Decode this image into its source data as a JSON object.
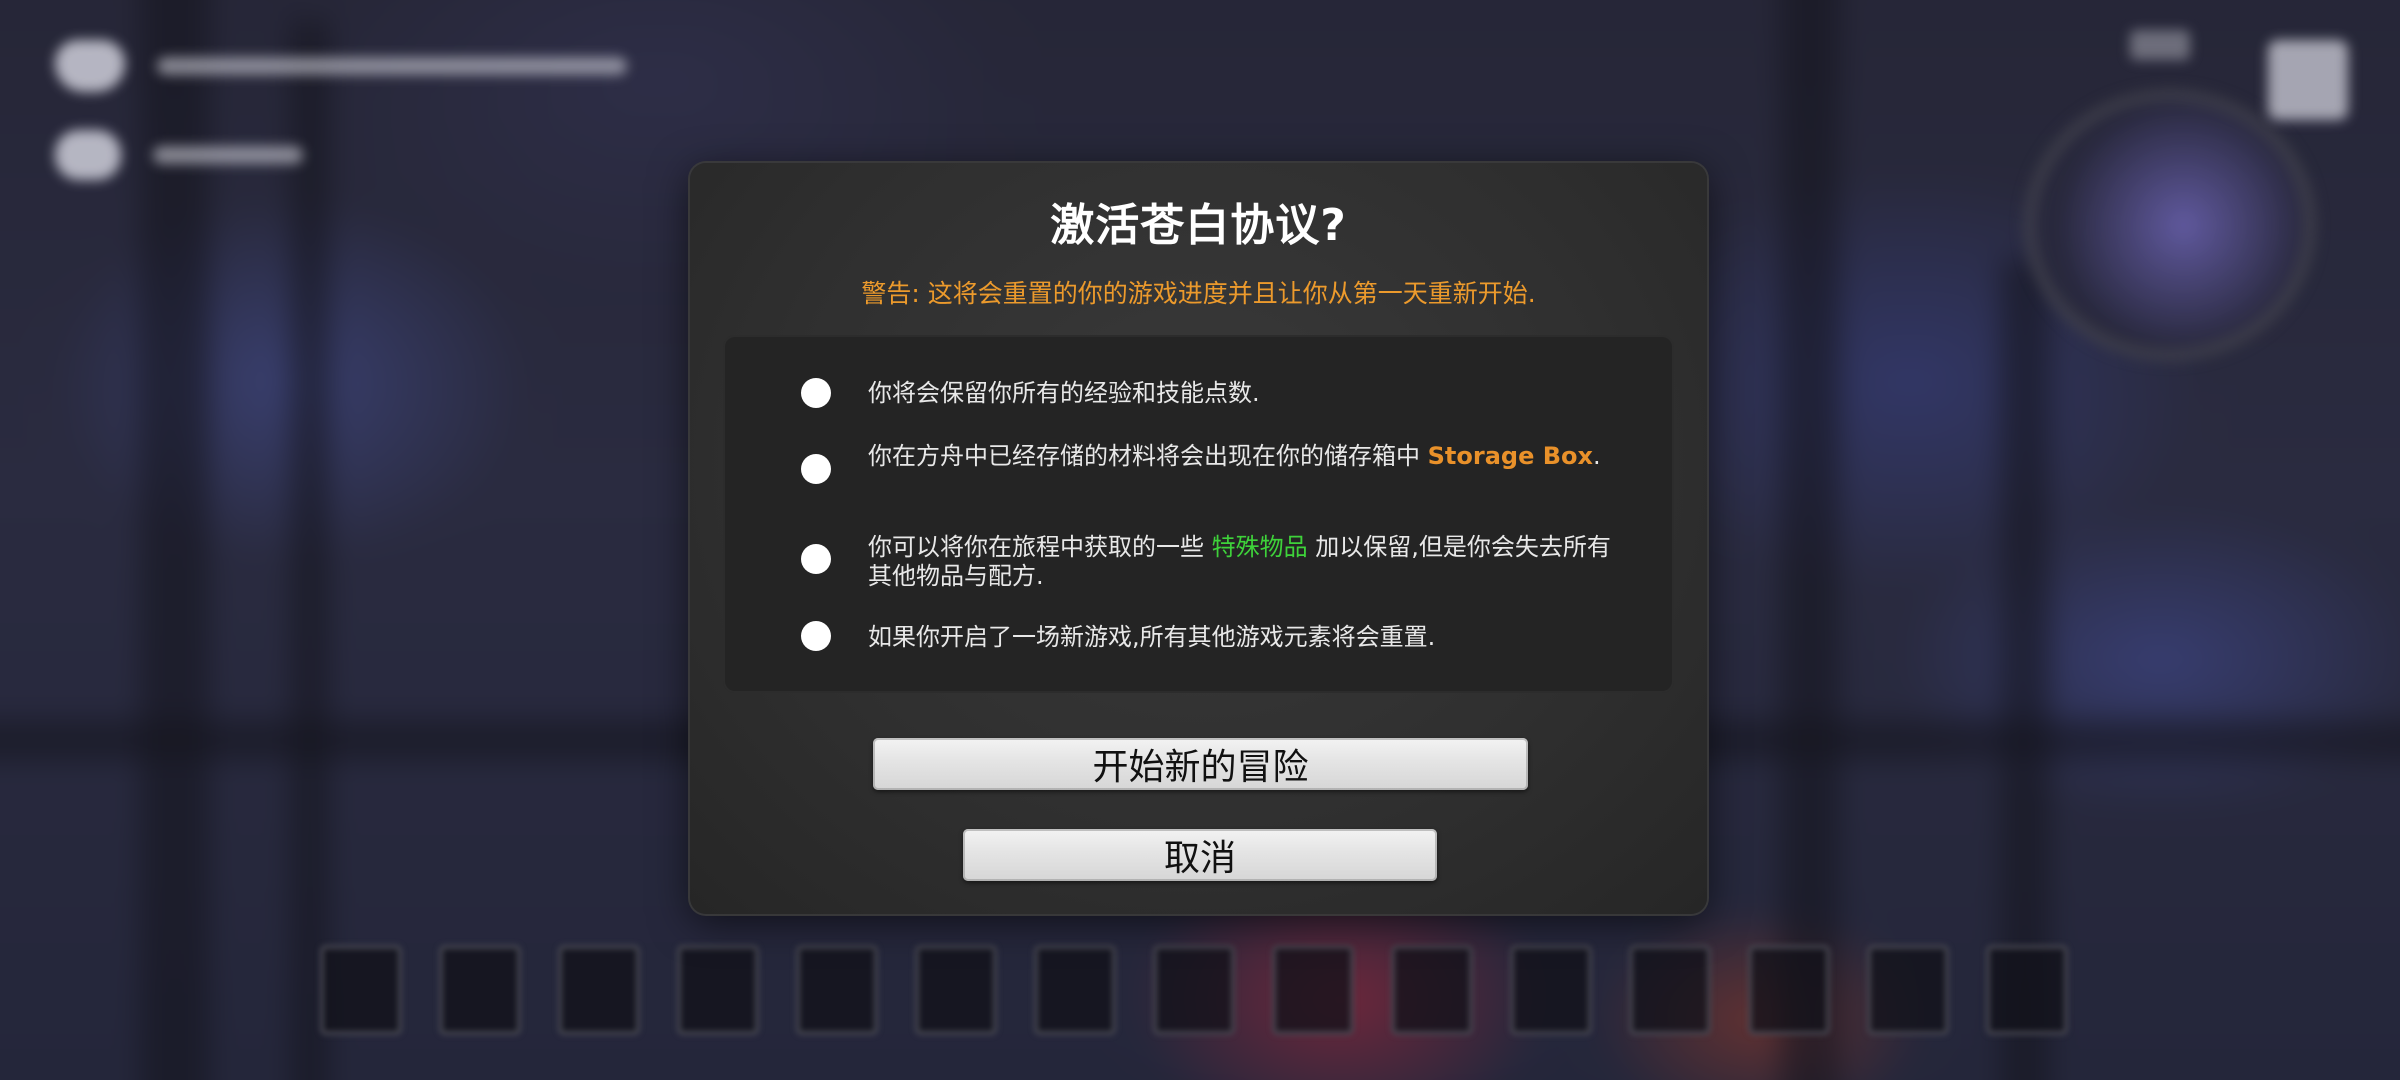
{
  "dialog": {
    "title": "激活苍白协议?",
    "warning": "警告: 这将会重置的你的游戏进度并且让你从第一天重新开始.",
    "items": [
      {
        "text": "你将会保留你所有的经验和技能点数."
      },
      {
        "prefix": "你在方舟中已经存储的材料将会出现在你的储存箱中 ",
        "highlight": "Storage Box",
        "suffix": "."
      },
      {
        "prefix": "你可以将你在旅程中获取的一些 ",
        "highlight": "特殊物品",
        "suffix": " 加以保留,但是你会失去所有其他物品与配方."
      },
      {
        "text": "如果你开启了一场新游戏,所有其他游戏元素将会重置."
      }
    ],
    "start_button": "开始新的冒险",
    "cancel_button": "取消"
  },
  "colors": {
    "warning": "#ec9a2c",
    "storage_box_highlight": "#e9912a",
    "special_items_highlight": "#3ed23a",
    "dialog_bg": "#333333",
    "panel_bg": "#242424"
  },
  "icons": {
    "hud_top": "heart-icon",
    "hud_second": "stamina-icon",
    "minimap": "minimap",
    "bullet": "bullet-dot-icon"
  }
}
